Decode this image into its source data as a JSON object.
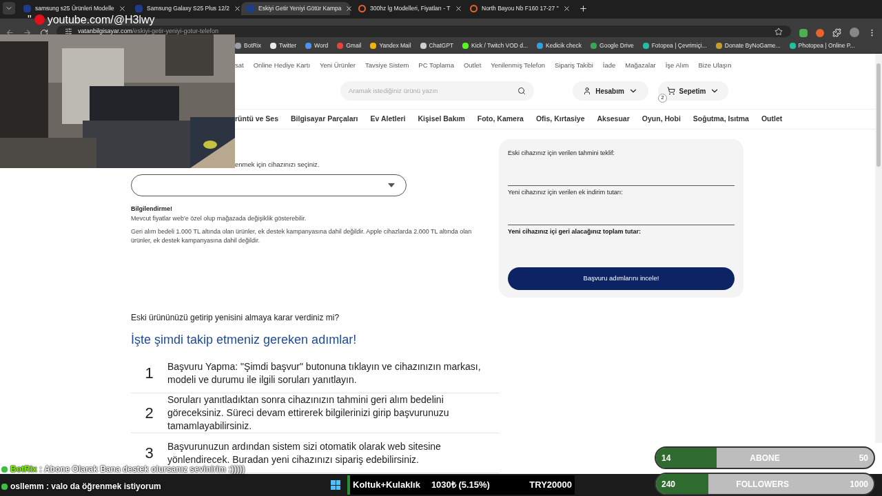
{
  "browser": {
    "tabs": [
      {
        "title": "samsung s25 Ürünleri Modelle",
        "selected": false
      },
      {
        "title": "Samsung Galaxy S25 Plus 12/2",
        "selected": false
      },
      {
        "title": "Eskiyi Getir Yeniyi Götür Kampa",
        "selected": true
      },
      {
        "title": "300hz lg Modelleri, Fiyatları - T",
        "selected": false
      },
      {
        "title": "North Bayou Nb F160 17-27 \"",
        "selected": false
      }
    ],
    "url_host": "vatanbilgisayar.com",
    "url_path": "/eskiyi-getir-yeniyi-gotur-telefon",
    "bookmarks": [
      {
        "label": "BotRix",
        "color": "#9aa0a6"
      },
      {
        "label": "Twitter",
        "color": "#e8eaed"
      },
      {
        "label": "Word",
        "color": "#4e8ef7"
      },
      {
        "label": "Gmail",
        "color": "#ea4335"
      },
      {
        "label": "Yandex Mail",
        "color": "#f5b400"
      },
      {
        "label": "ChatGPT",
        "color": "#cfcfcf"
      },
      {
        "label": "Kick / Twitch VOD d...",
        "color": "#53fc18"
      },
      {
        "label": "Kedicik check",
        "color": "#2aa3e0"
      },
      {
        "label": "Google Drive",
        "color": "#34a853"
      },
      {
        "label": "Fotopea | Çevrimiçi...",
        "color": "#1fbf9f"
      },
      {
        "label": "Donate ByNoGame...",
        "color": "#c89b2a"
      },
      {
        "label": "Photopea | Online P...",
        "color": "#1fbf9f"
      }
    ]
  },
  "overlay": {
    "channel": "youtube.com/@H3lwy",
    "quote": "\""
  },
  "site": {
    "top_links": [
      "sat",
      "Online Hediye Kartı",
      "Yeni Ürünler",
      "Tavsiye Sistem",
      "PC Toplama",
      "Outlet",
      "Yenilenmiş Telefon",
      "Sipariş Takibi",
      "İade",
      "Mağazalar",
      "İşe Alım",
      "Bize Ulaşın"
    ],
    "search_placeholder": "Aramak istediğiniz ürünü yazın",
    "account": "Hesabım",
    "cart": "Sepetim",
    "cart_count": "2",
    "categories": [
      "rüntü ve Ses",
      "Bilgisayar Parçaları",
      "Ev Aletleri",
      "Kişisel Bakım",
      "Foto, Kamera",
      "Ofis, Kırtasiye",
      "Aksesuar",
      "Oyun, Hobi",
      "Soğutma, Isıtma",
      "Outlet"
    ]
  },
  "form": {
    "prompt": "enmek için cihazınızı seçiniz.",
    "info_title": "Bilgilendirme!",
    "info_lines": [
      "Mevcut fiyatlar web'e özel olup mağazada değişiklik gösterebilir.",
      "Geri alım bedeli 1.000 TL altında olan ürünler, ek destek kampanyasına dahil değildir. Apple cihazlarda 2.000 TL altında olan ürünler, ek destek kampanyasına dahil değildir."
    ]
  },
  "offer_panel": {
    "fields": [
      {
        "label": "Eski cihazınız için verilen tahmini teklif:",
        "kind": "line"
      },
      {
        "label": "Yeni cihazınız için verilen ek indirim tutarı:",
        "kind": "line"
      },
      {
        "label": "Yeni cihazınız içi geri alacağınız toplam tutar:",
        "kind": "total"
      }
    ],
    "button": "Başvuru adımlarını incele!"
  },
  "steps_section": {
    "question": "Eski ürününüzü getirip yenisini almaya karar verdiniz mi?",
    "heading": "İşte şimdi takip etmeniz gereken adımlar!",
    "steps": [
      {
        "number": "1",
        "text": "Başvuru Yapma: \"Şimdi başvur\" butonuna tıklayın ve cihazınızın markası, modeli ve durumu ile ilgili soruları yanıtlayın."
      },
      {
        "number": "2",
        "text": "Soruları yanıtladıktan sonra cihazınızın tahmini geri alım bedelini göreceksiniz. Süreci devam ettirerek bilgilerinizi girip başvurunuzu tamamlayabilirsiniz."
      },
      {
        "number": "3",
        "text": "Başvurunuzun ardından sistem sizi otomatik olarak web sitesine yönlendirecek. Buradan yeni cihazınızı sipariş edebilirsiniz."
      }
    ]
  },
  "stream": {
    "chat": [
      {
        "user": "BotRix",
        "message": " : Abone Olarak Bana destek olursanız sevinirim :)))))",
        "color": "#7cfc00"
      },
      {
        "user": "osllemm",
        "message": " : valo da öğrenmek istiyorum",
        "color": "#ffffff"
      }
    ],
    "ticker": {
      "name": "Koltuk+Kulaklık",
      "price": "1030₺ (5.15%)",
      "goal": "TRY20000"
    },
    "goals": [
      {
        "current": "14",
        "label": "ABONE",
        "target": "50",
        "level": 0.28
      },
      {
        "current": "240",
        "label": "FOLLOWERS",
        "target": "1000",
        "level": 0.24
      }
    ]
  }
}
